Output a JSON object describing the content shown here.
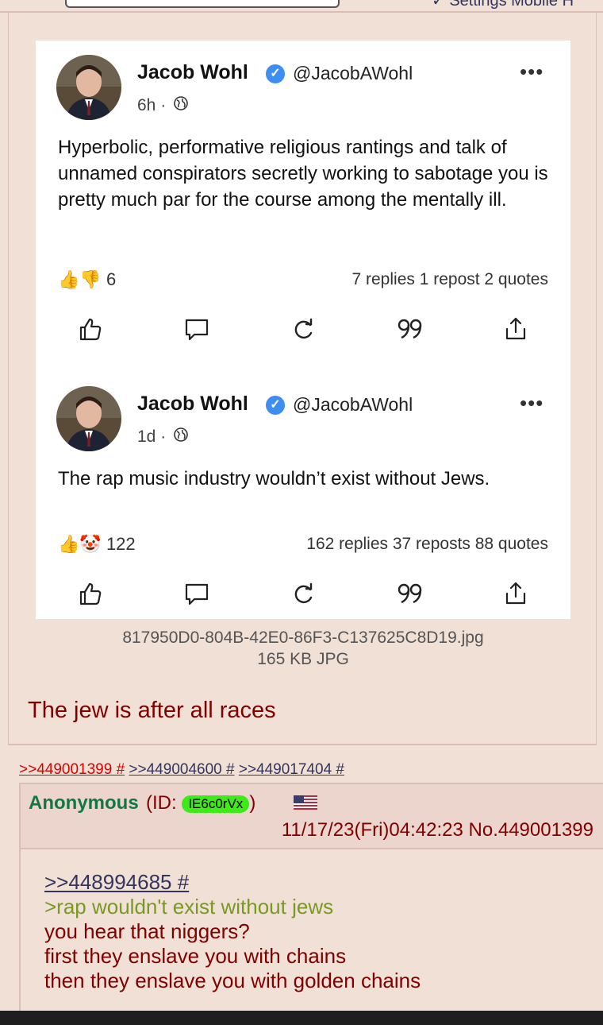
{
  "topbar": {
    "nav": "✓ Settings Mobile H"
  },
  "tweets": [
    {
      "name": "Jacob Wohl",
      "handle": "@JacobAWohl",
      "time": "6h",
      "text": "Hyperbolic, performative religious rantings and talk of unnamed conspirators secretly working to sabotage you is pretty much par for the course among the mentally ill.",
      "reaction_count": "6",
      "stats": "7 replies  1 repost  2 quotes"
    },
    {
      "name": "Jacob Wohl",
      "handle": "@JacobAWohl",
      "time": "1d",
      "text": "The rap music industry wouldn’t exist without Jews.",
      "reaction_count": "122",
      "stats": "162 replies  37 reposts  88 quotes"
    }
  ],
  "file": {
    "name": "817950D0-804B-42E0-86F3-C137625C8D19.jpg",
    "size": "165 KB JPG"
  },
  "post1": {
    "text": "The jew is after all races"
  },
  "backlinks": [
    {
      "text": ">>449001399 #",
      "highlight": true
    },
    {
      "text": ">>449004600 #",
      "highlight": false
    },
    {
      "text": ">>449017404 #",
      "highlight": false
    }
  ],
  "post2": {
    "name": "Anonymous",
    "id_prefix": "(ID: ",
    "id": "IE6c0rVx",
    "id_suffix": ")",
    "datetime": "11/17/23(Fri)04:42:23 No.449001399",
    "quotelink": ">>448994685 #",
    "greentext": ">rap wouldn't exist without jews",
    "lines": [
      "you hear that niggers?",
      "first they enslave you with chains",
      "then they enslave you with golden chains"
    ]
  },
  "colors": {
    "post_bg": "#f0e0d6",
    "header_bg": "#ebd5cc",
    "border": "#d9bfb7",
    "post_text": "#800000",
    "name_green": "#117743",
    "greentext": "#789922",
    "link": "#34345c",
    "id_pill": "#3eea17"
  }
}
